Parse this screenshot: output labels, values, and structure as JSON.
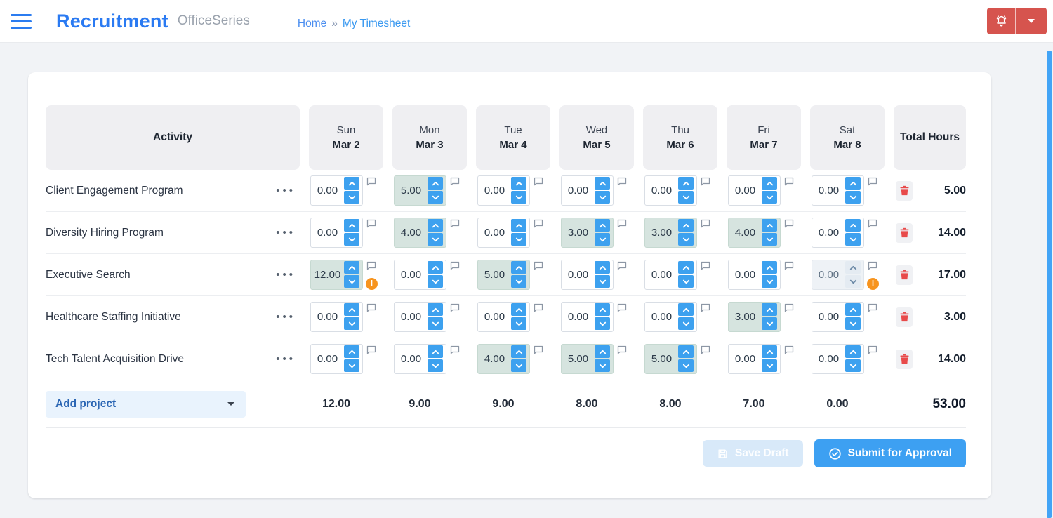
{
  "header": {
    "app_title": "Recruitment",
    "suite_name": "OfficeSeries",
    "breadcrumb": {
      "home": "Home",
      "separator": "»",
      "current": "My Timesheet"
    }
  },
  "colors": {
    "brand_blue": "#2a7af2",
    "accent_blue": "#3da1ef",
    "link_blue": "#3898f0",
    "danger_red": "#d6544e",
    "trash_red": "#e84a4a",
    "filled_cell_green": "#d6e4df",
    "warning_orange": "#f7941e",
    "scrollbar_blue": "#42a4f6"
  },
  "timesheet": {
    "activity_header": "Activity",
    "total_header": "Total Hours",
    "row_options_glyph": "•••",
    "warning_glyph": "i",
    "columns": [
      {
        "day": "Sun",
        "date": "Mar 2"
      },
      {
        "day": "Mon",
        "date": "Mar 3"
      },
      {
        "day": "Tue",
        "date": "Mar 4"
      },
      {
        "day": "Wed",
        "date": "Mar 5"
      },
      {
        "day": "Thu",
        "date": "Mar 6"
      },
      {
        "day": "Fri",
        "date": "Mar 7"
      },
      {
        "day": "Sat",
        "date": "Mar 8"
      }
    ],
    "rows": [
      {
        "name": "Client Engagement Program",
        "cells": [
          {
            "value": "0.00",
            "state": "zero",
            "warning": false
          },
          {
            "value": "5.00",
            "state": "filled",
            "warning": false
          },
          {
            "value": "0.00",
            "state": "zero",
            "warning": false
          },
          {
            "value": "0.00",
            "state": "zero",
            "warning": false
          },
          {
            "value": "0.00",
            "state": "zero",
            "warning": false
          },
          {
            "value": "0.00",
            "state": "zero",
            "warning": false
          },
          {
            "value": "0.00",
            "state": "zero",
            "warning": false
          }
        ],
        "total": "5.00"
      },
      {
        "name": "Diversity Hiring Program",
        "cells": [
          {
            "value": "0.00",
            "state": "zero",
            "warning": false
          },
          {
            "value": "4.00",
            "state": "filled",
            "warning": false
          },
          {
            "value": "0.00",
            "state": "zero",
            "warning": false
          },
          {
            "value": "3.00",
            "state": "filled",
            "warning": false
          },
          {
            "value": "3.00",
            "state": "filled",
            "warning": false
          },
          {
            "value": "4.00",
            "state": "filled",
            "warning": false
          },
          {
            "value": "0.00",
            "state": "zero",
            "warning": false
          }
        ],
        "total": "14.00"
      },
      {
        "name": "Executive Search",
        "cells": [
          {
            "value": "12.00",
            "state": "filled",
            "warning": true
          },
          {
            "value": "0.00",
            "state": "zero",
            "warning": false
          },
          {
            "value": "5.00",
            "state": "filled",
            "warning": false
          },
          {
            "value": "0.00",
            "state": "zero",
            "warning": false
          },
          {
            "value": "0.00",
            "state": "zero",
            "warning": false
          },
          {
            "value": "0.00",
            "state": "zero",
            "warning": false
          },
          {
            "value": "0.00",
            "state": "disabled",
            "warning": true
          }
        ],
        "total": "17.00"
      },
      {
        "name": "Healthcare Staffing Initiative",
        "cells": [
          {
            "value": "0.00",
            "state": "zero",
            "warning": false
          },
          {
            "value": "0.00",
            "state": "zero",
            "warning": false
          },
          {
            "value": "0.00",
            "state": "zero",
            "warning": false
          },
          {
            "value": "0.00",
            "state": "zero",
            "warning": false
          },
          {
            "value": "0.00",
            "state": "zero",
            "warning": false
          },
          {
            "value": "3.00",
            "state": "filled",
            "warning": false
          },
          {
            "value": "0.00",
            "state": "zero",
            "warning": false
          }
        ],
        "total": "3.00"
      },
      {
        "name": "Tech Talent Acquisition Drive",
        "cells": [
          {
            "value": "0.00",
            "state": "zero",
            "warning": false
          },
          {
            "value": "0.00",
            "state": "zero",
            "warning": false
          },
          {
            "value": "4.00",
            "state": "filled",
            "warning": false
          },
          {
            "value": "5.00",
            "state": "filled",
            "warning": false
          },
          {
            "value": "5.00",
            "state": "filled",
            "warning": false
          },
          {
            "value": "0.00",
            "state": "zero",
            "warning": false
          },
          {
            "value": "0.00",
            "state": "zero",
            "warning": false
          }
        ],
        "total": "14.00"
      }
    ],
    "footer": {
      "add_project_label": "Add project",
      "day_totals": [
        "12.00",
        "9.00",
        "9.00",
        "8.00",
        "8.00",
        "7.00",
        "0.00"
      ],
      "grand_total": "53.00"
    },
    "actions": {
      "save_draft": "Save Draft",
      "submit": "Submit for Approval"
    }
  }
}
